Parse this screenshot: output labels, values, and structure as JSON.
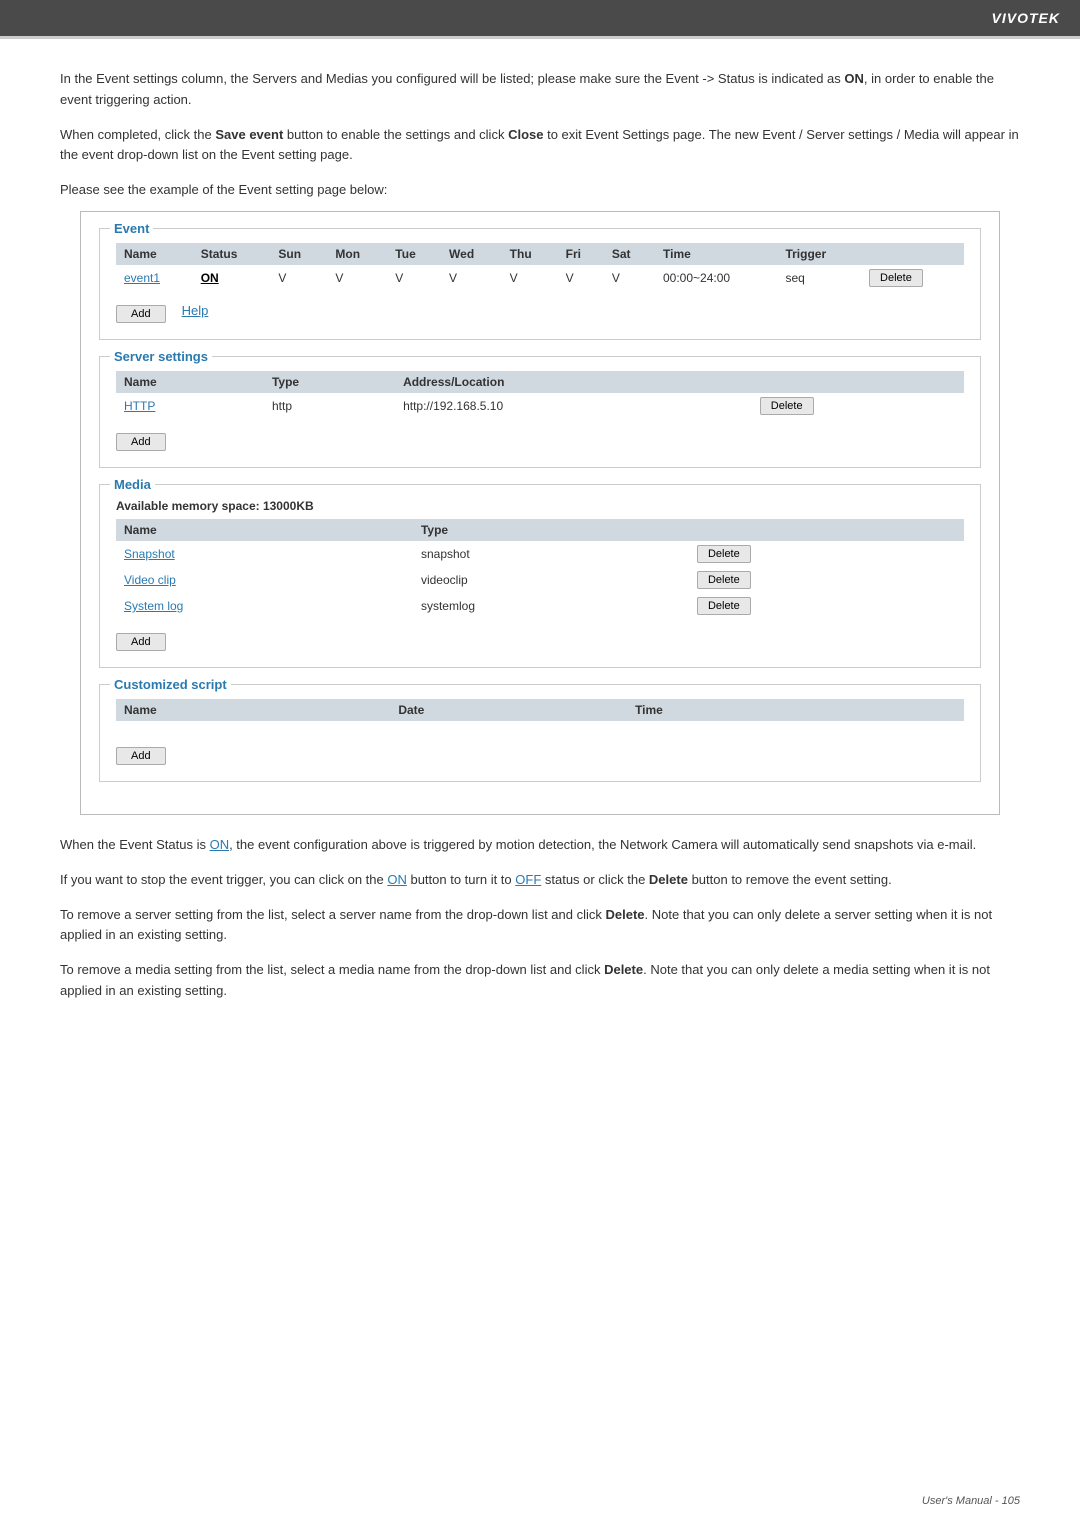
{
  "header": {
    "brand": "VIVOTEK"
  },
  "intro": {
    "para1": "In the Event settings column, the Servers and Medias you configured will be listed; please make sure the Event -> Status is indicated as ",
    "para1_on": "ON",
    "para1_rest": ", in order to enable the event triggering action.",
    "para2_a": "When  completed, click the ",
    "para2_save": "Save event",
    "para2_b": " button to enable the settings and click ",
    "para2_close": "Close",
    "para2_rest": " to exit Event Settings page. The new Event / Server settings / Media will appear in the event drop-down list on the Event setting page.",
    "example_label": "Please see the example of the Event setting page below:"
  },
  "event_section": {
    "title": "Event",
    "table": {
      "headers": [
        "Name",
        "Status",
        "Sun",
        "Mon",
        "Tue",
        "Wed",
        "Thu",
        "Fri",
        "Sat",
        "Time",
        "Trigger",
        ""
      ],
      "rows": [
        {
          "name": "event1",
          "status": "ON",
          "sun": "V",
          "mon": "V",
          "tue": "V",
          "wed": "V",
          "thu": "V",
          "fri": "V",
          "sat": "V",
          "time": "00:00~24:00",
          "trigger": "seq",
          "action": "Delete"
        }
      ]
    },
    "add_btn": "Add",
    "help_link": "Help"
  },
  "server_settings": {
    "title": "Server settings",
    "table": {
      "headers": [
        "Name",
        "Type",
        "Address/Location",
        ""
      ],
      "rows": [
        {
          "name": "HTTP",
          "type": "http",
          "address": "http://192.168.5.10",
          "action": "Delete"
        }
      ]
    },
    "add_btn": "Add"
  },
  "media": {
    "title": "Media",
    "available_space": "Available memory space: 13000KB",
    "table": {
      "headers": [
        "Name",
        "Type",
        ""
      ],
      "rows": [
        {
          "name": "Snapshot",
          "type": "snapshot",
          "action": "Delete"
        },
        {
          "name": "Video clip",
          "type": "videoclip",
          "action": "Delete"
        },
        {
          "name": "System log",
          "type": "systemlog",
          "action": "Delete"
        }
      ]
    },
    "add_btn": "Add"
  },
  "customized_script": {
    "title": "Customized script",
    "table": {
      "headers": [
        "Name",
        "Date",
        "Time",
        ""
      ],
      "rows": []
    },
    "add_btn": "Add"
  },
  "bottom": {
    "para1_a": "When the Event Status is ",
    "para1_on": "ON",
    "para1_b": ", the event configuration above is triggered by motion detection, the Network Camera will  automatically send snapshots via e-mail.",
    "para2_a": "If you want to stop the event trigger, you can click on the ",
    "para2_on": "ON",
    "para2_b": " button to turn it to ",
    "para2_off": "OFF",
    "para2_c": " status or click the ",
    "para2_delete": "Delete",
    "para2_d": " button to remove the event setting.",
    "para3_a": "To remove a server setting from the list, select a server name from the drop-down list and click ",
    "para3_delete": "Delete",
    "para3_b": ". Note that you can only delete a server setting when it is not applied in an existing setting.",
    "para4_a": "To remove a media setting from the list, select a media name from the drop-down list and click ",
    "para4_delete": "Delete",
    "para4_b": ". Note that you can only delete a media setting when it is not applied in an existing setting."
  },
  "footer": {
    "text": "User's Manual - 105"
  }
}
